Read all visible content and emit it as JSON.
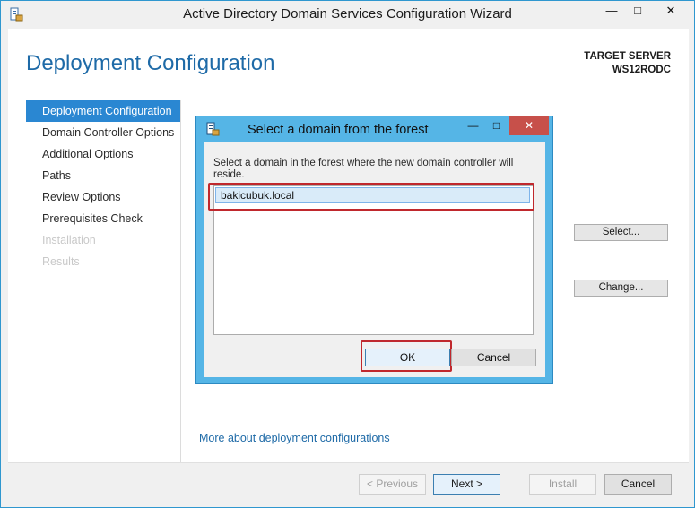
{
  "window": {
    "title": "Active Directory Domain Services Configuration Wizard",
    "controls": {
      "minimize": "—",
      "maximize": "□",
      "close": "✕"
    }
  },
  "page": {
    "title": "Deployment Configuration",
    "target_label": "TARGET SERVER",
    "target_name": "WS12RODC"
  },
  "nav": {
    "items": [
      {
        "label": "Deployment Configuration",
        "state": "active"
      },
      {
        "label": "Domain Controller Options",
        "state": "normal"
      },
      {
        "label": "Additional Options",
        "state": "normal"
      },
      {
        "label": "Paths",
        "state": "normal"
      },
      {
        "label": "Review Options",
        "state": "normal"
      },
      {
        "label": "Prerequisites Check",
        "state": "normal"
      },
      {
        "label": "Installation",
        "state": "disabled"
      },
      {
        "label": "Results",
        "state": "disabled"
      }
    ]
  },
  "side_buttons": {
    "select": "Select...",
    "change": "Change..."
  },
  "more_link": "More about deployment configurations",
  "footer": {
    "previous": "< Previous",
    "next": "Next >",
    "install": "Install",
    "cancel": "Cancel"
  },
  "dialog": {
    "title": "Select a domain from the forest",
    "instruction": "Select a domain in the forest where the new domain controller will reside.",
    "domains": [
      "bakicubuk.local"
    ],
    "ok": "OK",
    "cancel": "Cancel",
    "controls": {
      "minimize": "—",
      "maximize": "□",
      "close": "✕"
    }
  },
  "colors": {
    "accent": "#2a87d2",
    "title_blue": "#1e6aa7",
    "dialog_frame": "#55b5e6",
    "highlight_red": "#c0282d"
  }
}
